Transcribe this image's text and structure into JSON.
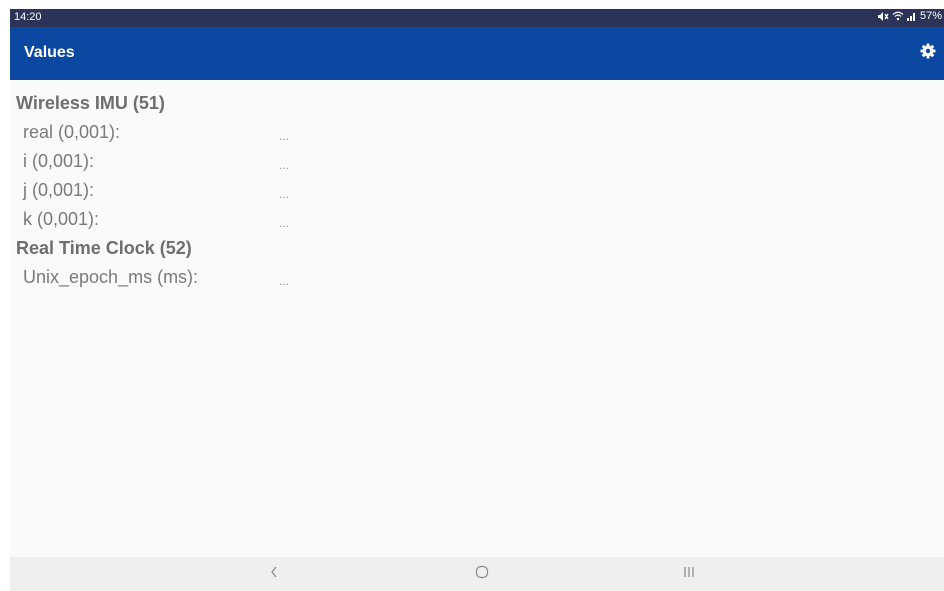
{
  "status_bar": {
    "time": "14:20",
    "battery": "57%",
    "icons": [
      "mute-icon",
      "wifi-icon",
      "signal-icon"
    ]
  },
  "app_bar": {
    "title": "Values",
    "settings_icon": "gear-icon",
    "color": "#0b48a2"
  },
  "sections": [
    {
      "title": "Wireless IMU (51)",
      "rows": [
        {
          "label": "real (0,001):",
          "value": "..."
        },
        {
          "label": "i (0,001):",
          "value": "..."
        },
        {
          "label": "j (0,001):",
          "value": "..."
        },
        {
          "label": "k (0,001):",
          "value": "..."
        }
      ]
    },
    {
      "title": "Real Time Clock (52)",
      "rows": [
        {
          "label": "Unix_epoch_ms (ms):",
          "value": "..."
        }
      ]
    }
  ],
  "nav_bar": {
    "icons": [
      "back-icon",
      "home-icon",
      "recents-icon"
    ]
  }
}
